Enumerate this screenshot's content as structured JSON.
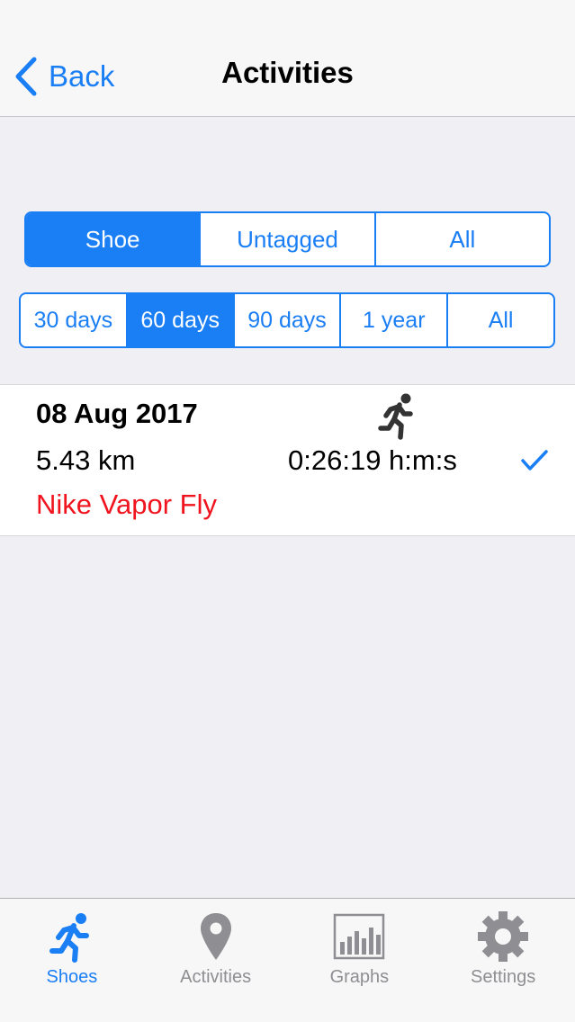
{
  "nav": {
    "back_label": "Back",
    "title": "Activities"
  },
  "filter_tags": {
    "options": [
      "Shoe",
      "Untagged",
      "All"
    ],
    "selected": "Shoe"
  },
  "filter_period": {
    "options": [
      "30 days",
      "60 days",
      "90 days",
      "1 year",
      "All"
    ],
    "selected": "60 days"
  },
  "activities": [
    {
      "date": "08 Aug 2017",
      "distance": "5.43 km",
      "duration": "0:26:19 h:m:s",
      "shoe": "Nike Vapor Fly",
      "icon": "runner-icon",
      "checked": true
    }
  ],
  "tabbar": {
    "items": [
      {
        "label": "Shoes",
        "icon": "runner-icon",
        "active": true
      },
      {
        "label": "Activities",
        "icon": "map-pin-icon",
        "active": false
      },
      {
        "label": "Graphs",
        "icon": "bar-chart-icon",
        "active": false
      },
      {
        "label": "Settings",
        "icon": "gear-icon",
        "active": false
      }
    ]
  },
  "colors": {
    "accent": "#1a7ef5",
    "shoe_text": "#f0141e",
    "inactive": "#8e8e93"
  }
}
